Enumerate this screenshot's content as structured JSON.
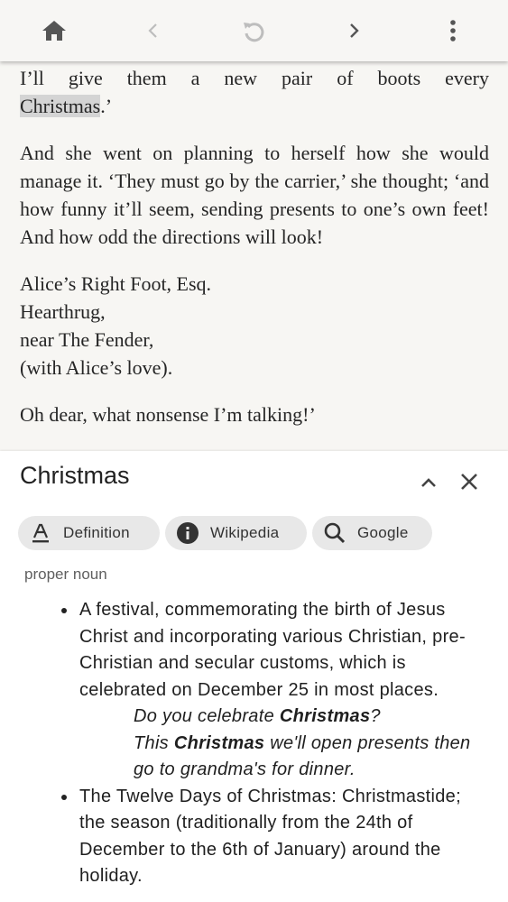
{
  "toolbar": {
    "icons": [
      "home-icon",
      "chevron-left-icon",
      "rotate-icon",
      "chevron-right-icon",
      "more-vert-icon"
    ],
    "color": "#555555",
    "disabled_color": "#bdbdbd"
  },
  "reader": {
    "line1": "I’ll give them a new pair of boots every",
    "highlighted_word": "Christmas",
    "line2_tail": ".’",
    "paragraph2": "And she went on planning to herself how she would manage it. ‘They must go by the carrier,’ she thought; ‘and how funny it’ll seem, sending presents to one’s own feet! And how odd the directions will look!",
    "address": [
      "Alice’s Right Foot, Esq.",
      "Hearthrug,",
      "near The Fender,",
      "(with Alice’s love)."
    ],
    "paragraph4": "Oh dear, what nonsense I’m talking!’",
    "highlight_color": "#d4d4d4"
  },
  "panel": {
    "title": "Christmas",
    "collapse_icon": "chevron-up-icon",
    "close_icon": "close-icon",
    "tabs": [
      {
        "label": "Definition",
        "icon": "text-format-icon"
      },
      {
        "label": "Wikipedia",
        "icon": "info-icon"
      },
      {
        "label": "Google",
        "icon": "search-icon"
      }
    ],
    "part_of_speech": "proper noun",
    "definitions": [
      {
        "text": "A festival, commemorating the birth of Jesus Christ and incorporating various Christian, pre-Christian and secular customs, which is celebrated on December 25 in most places.",
        "examples": [
          {
            "pre": "Do you celebrate ",
            "bold": "Christmas",
            "post": "?"
          },
          {
            "pre": "This ",
            "bold": "Christmas",
            "post": " we'll open presents then go to grandma's for dinner."
          }
        ]
      },
      {
        "text": "The Twelve Days of Christmas: Christmastide; the season (traditionally from the 24th of December to the 6th of January) around the holiday."
      }
    ]
  }
}
